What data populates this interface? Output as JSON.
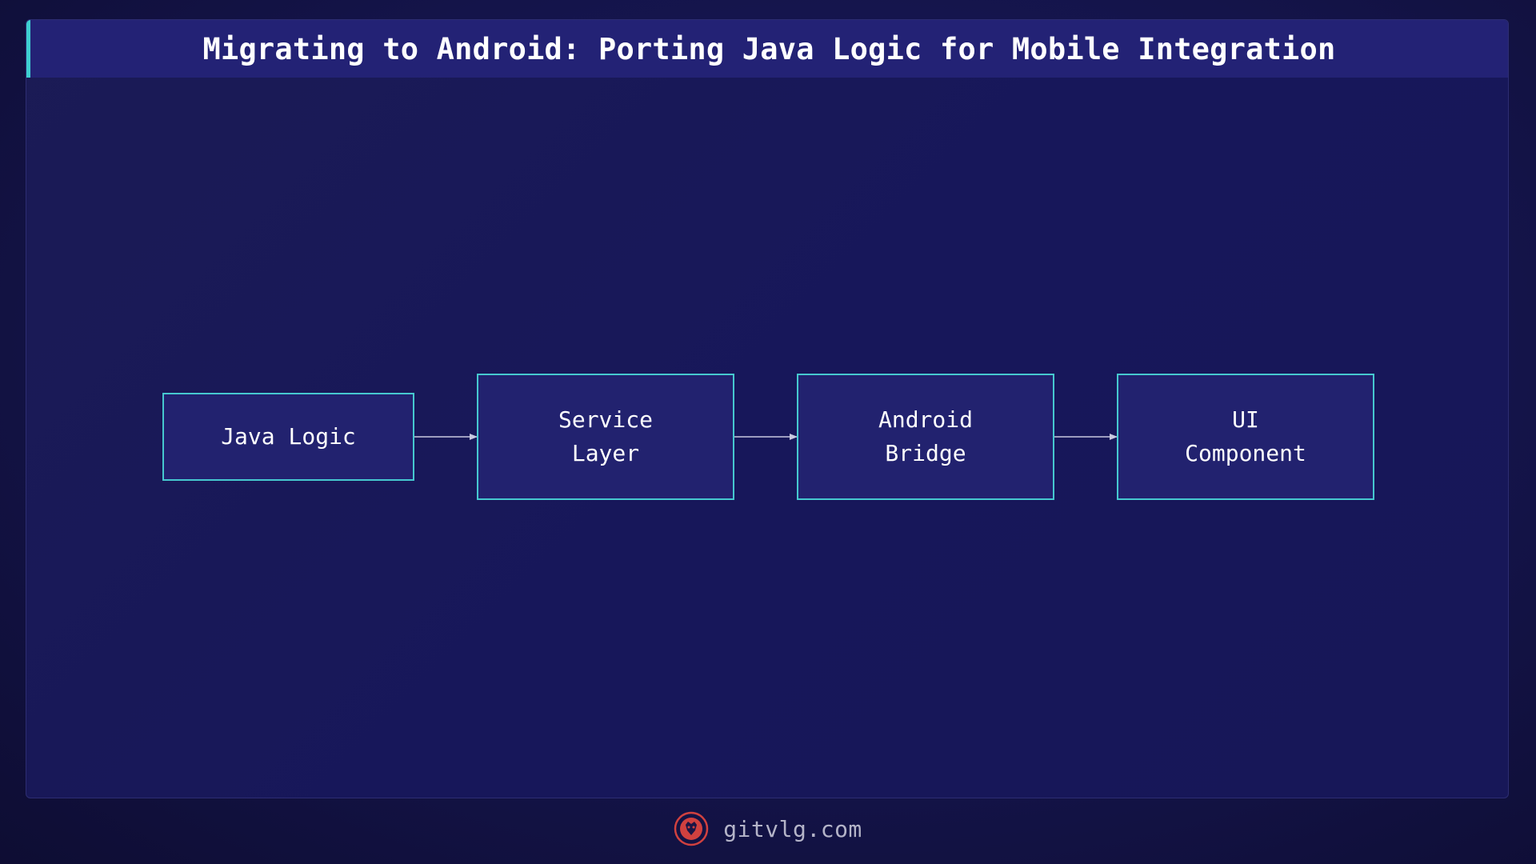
{
  "title": "Migrating to Android: Porting Java Logic for Mobile Integration",
  "diagram": {
    "nodes": [
      {
        "id": "java-logic",
        "label": "Java Logic"
      },
      {
        "id": "service-layer",
        "label": "Service\nLayer"
      },
      {
        "id": "android-bridge",
        "label": "Android\nBridge"
      },
      {
        "id": "ui-component",
        "label": "UI\nComponent"
      }
    ],
    "edges": [
      {
        "from": "java-logic",
        "to": "service-layer"
      },
      {
        "from": "service-layer",
        "to": "android-bridge"
      },
      {
        "from": "android-bridge",
        "to": "ui-component"
      }
    ]
  },
  "footer": {
    "site": "gitvlg.com",
    "logo_icon": "lion-head-icon"
  },
  "colors": {
    "accent": "#3ecfd0",
    "node_fill": "#22226f",
    "node_border": "#46c8cf",
    "title_bar": "#232275",
    "logo": "#d0413f"
  }
}
